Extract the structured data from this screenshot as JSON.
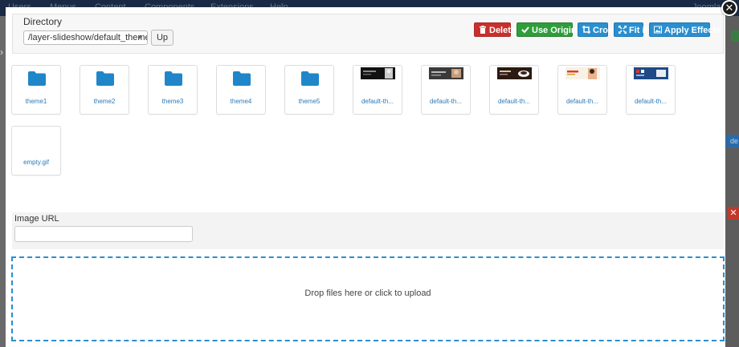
{
  "background": {
    "nav_items": [
      "Users",
      "Menus",
      "Content",
      "Components",
      "Extensions",
      "Help"
    ],
    "right_text": "Joomla",
    "blue_tab_text": "de",
    "red_tab_glyph": "✕"
  },
  "modal": {
    "close_glyph": "✕"
  },
  "toolbar": {
    "directory_label": "Directory",
    "directory_value": "/layer-slideshow/default_theme",
    "up_label": "Up",
    "delete_label": "Delete",
    "use_original_label": "Use Original",
    "crop_label": "Crop",
    "fit_label": "Fit it",
    "apply_effects_label": "Apply Effects"
  },
  "grid": {
    "items": [
      {
        "name": "theme1",
        "type": "folder"
      },
      {
        "name": "theme2",
        "type": "folder"
      },
      {
        "name": "theme3",
        "type": "folder"
      },
      {
        "name": "theme4",
        "type": "folder"
      },
      {
        "name": "theme5",
        "type": "folder"
      },
      {
        "name": "default-th...",
        "type": "image"
      },
      {
        "name": "default-th...",
        "type": "image"
      },
      {
        "name": "default-th...",
        "type": "image"
      },
      {
        "name": "default-th...",
        "type": "image"
      },
      {
        "name": "default-th...",
        "type": "image"
      },
      {
        "name": "empty.gif",
        "type": "file"
      }
    ]
  },
  "image_url": {
    "label": "Image URL",
    "value": ""
  },
  "dropzone": {
    "message": "Drop files here or click to upload"
  },
  "colors": {
    "danger": "#c9302c",
    "success": "#2e9e3a",
    "primary": "#2a8fd0",
    "folder": "#1f86c9",
    "link": "#2a7ab8"
  }
}
